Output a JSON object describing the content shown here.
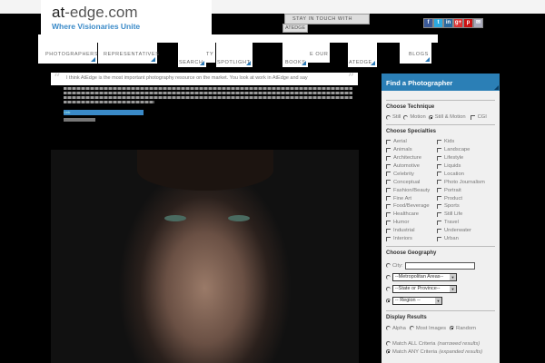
{
  "header": {
    "logo_bold": "at",
    "logo_rest": "-edge.com",
    "tagline": "Where Visionaries Unite",
    "stay_in_touch": "STAY IN TOUCH WITH",
    "stay_in_touch2": "ATEDGE"
  },
  "social": [
    "f",
    "t",
    "in",
    "g+",
    "p",
    "✉"
  ],
  "nav": [
    "PHOTOGRAPHERS",
    "REPRESENTATIVES",
    "SEARCH",
    "TY",
    "SPOTLIGHT",
    "BOOKS",
    "E OUR",
    "ATEDGE",
    "BLOGS"
  ],
  "quote": {
    "text": "I think AtEdge is the most important photography resource on the market. You look at work in AtEdge and say",
    "link": "Link",
    "date": "date"
  },
  "sidebar": {
    "title": "Find a Photographer",
    "technique_label": "Choose Technique",
    "techniques": [
      "Still",
      "Motion",
      "Still & Motion",
      "CGI"
    ],
    "specialties_label": "Choose Specialties",
    "specialties_col1": [
      "Aerial",
      "Animals",
      "Architecture",
      "Automotive",
      "Celebrity",
      "Conceptual",
      "Fashion/Beauty",
      "Fine Art",
      "Food/Beverage",
      "Healthcare",
      "Humor",
      "Industrial",
      "Interiors"
    ],
    "specialties_col2": [
      "Kids",
      "Landscape",
      "Lifestyle",
      "Liquids",
      "Location",
      "Photo Journalism",
      "Portrait",
      "Product",
      "Sports",
      "Still Life",
      "Travel",
      "Underwater",
      "Urban"
    ],
    "geography_label": "Choose Geography",
    "city_label": "City:",
    "metro": "--Metropolitan Areas--",
    "state": "--State or Province--",
    "region": "-- Region --",
    "display_label": "Display Results",
    "display": [
      "Alpha",
      "Most Images",
      "Random"
    ],
    "match_all": "Match ALL Criteria",
    "match_all_note": "(narrowed results)",
    "match_any": "Match ANY Criteria",
    "match_any_note": "(expanded results)"
  }
}
